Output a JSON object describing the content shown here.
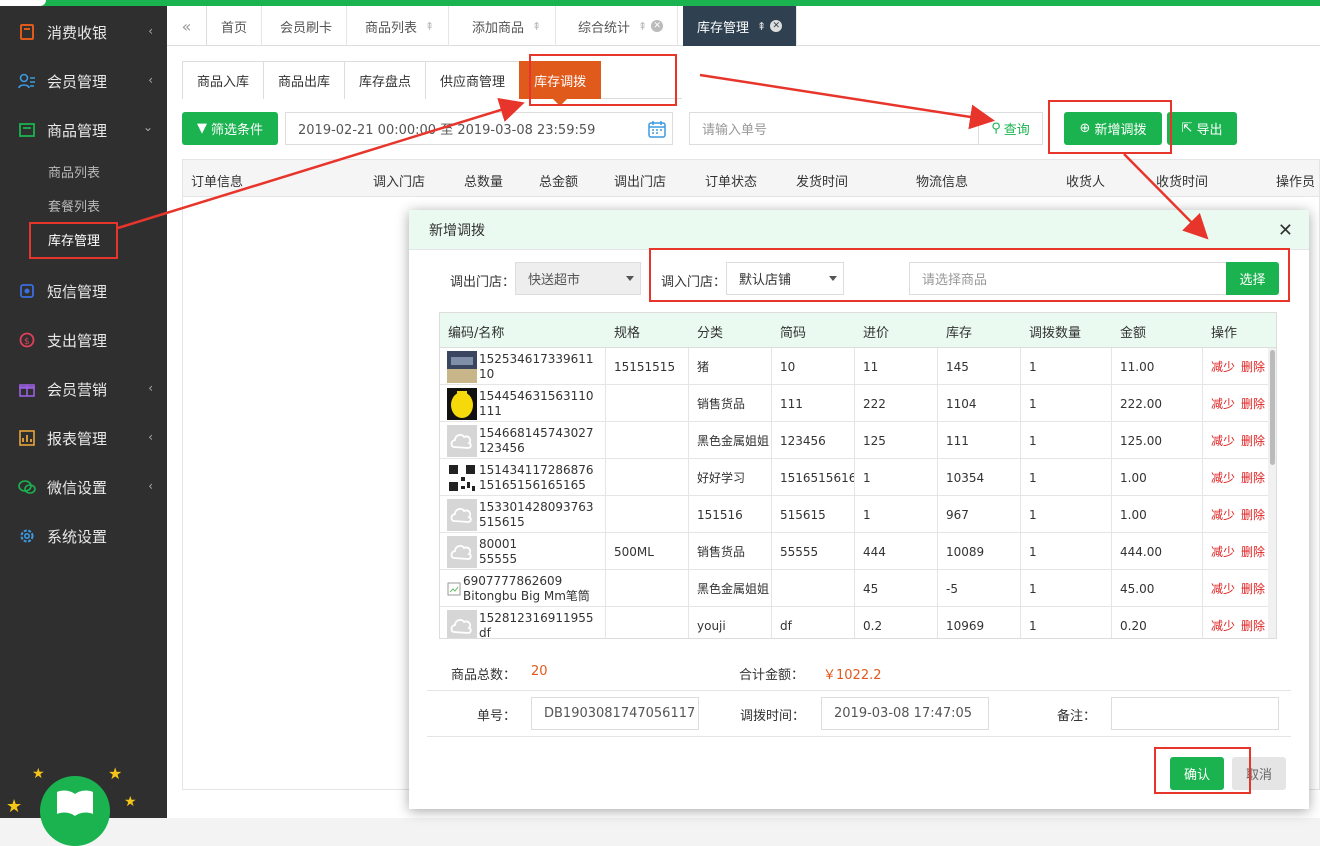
{
  "colors": {
    "green": "#1ab34f",
    "orange": "#e05a1c",
    "sidebar": "#2f2f2f",
    "red_annotation": "#e8352b"
  },
  "sidebar": {
    "items": [
      {
        "label": "消费收银",
        "icon": "cash-register-icon",
        "chevron": "‹"
      },
      {
        "label": "会员管理",
        "icon": "members-icon",
        "chevron": "‹"
      },
      {
        "label": "商品管理",
        "icon": "goods-icon",
        "chevron": "⌄"
      },
      {
        "label": "短信管理",
        "icon": "sms-icon"
      },
      {
        "label": "支出管理",
        "icon": "expense-icon"
      },
      {
        "label": "会员营销",
        "icon": "gift-icon",
        "chevron": "‹"
      },
      {
        "label": "报表管理",
        "icon": "report-icon",
        "chevron": "‹"
      },
      {
        "label": "微信设置",
        "icon": "wechat-icon",
        "chevron": "‹"
      },
      {
        "label": "系统设置",
        "icon": "settings-icon"
      }
    ],
    "subitems": [
      {
        "label": "商品列表"
      },
      {
        "label": "套餐列表"
      },
      {
        "label": "库存管理"
      }
    ]
  },
  "tabs": [
    {
      "label": "首页"
    },
    {
      "label": "会员刷卡"
    },
    {
      "label": "商品列表"
    },
    {
      "label": "添加商品"
    },
    {
      "label": "综合统计"
    },
    {
      "label": "库存管理"
    }
  ],
  "subtabs": [
    {
      "label": "商品入库"
    },
    {
      "label": "商品出库"
    },
    {
      "label": "库存盘点"
    },
    {
      "label": "供应商管理"
    },
    {
      "label": "库存调拨"
    }
  ],
  "toolbar": {
    "filter_label": "筛选条件",
    "date_range": "2019-02-21 00:00:00 至 2019-03-08 23:59:59",
    "order_placeholder": "请输入单号",
    "query_label": "查询",
    "new_transfer_label": "新增调拨",
    "export_label": "导出"
  },
  "list_columns": [
    "订单信息",
    "调入门店",
    "总数量",
    "总金额",
    "调出门店",
    "订单状态",
    "发货时间",
    "物流信息",
    "收货人",
    "收货时间",
    "操作员"
  ],
  "modal": {
    "title": "新增调拨",
    "out_store_label": "调出门店：",
    "out_store_value": "快送超市",
    "in_store_label": "调入门店：",
    "in_store_value": "默认店铺",
    "product_placeholder": "请选择商品",
    "choose_label": "选择",
    "columns": [
      "编码/名称",
      "规格",
      "分类",
      "简码",
      "进价",
      "库存",
      "调拨数量",
      "金额",
      "操作"
    ],
    "rows": [
      {
        "code1": "152534617339611",
        "code2": "10",
        "spec": "15151515",
        "category": "猪",
        "short": "10",
        "price": "11",
        "stock": "145",
        "qty": "1",
        "amount": "11.00",
        "thumb": "photo-dark"
      },
      {
        "code1": "154454631563110",
        "code2": "111",
        "spec": "",
        "category": "销售货品",
        "short": "111",
        "price": "222",
        "stock": "1104",
        "qty": "1",
        "amount": "222.00",
        "thumb": "photo-yellow"
      },
      {
        "code1": "154668145743027",
        "code2": "123456",
        "spec": "",
        "category": "黑色金属姐姐",
        "short": "123456",
        "price": "125",
        "stock": "111",
        "qty": "1",
        "amount": "125.00",
        "thumb": "placeholder"
      },
      {
        "code1": "151434117286876",
        "code2": "15165156165165",
        "spec": "",
        "category": "好好学习",
        "short": "1516515616",
        "price": "1",
        "stock": "10354",
        "qty": "1",
        "amount": "1.00",
        "thumb": "qr"
      },
      {
        "code1": "153301428093763",
        "code2": "515615",
        "spec": "",
        "category": "151516",
        "short": "515615",
        "price": "1",
        "stock": "967",
        "qty": "1",
        "amount": "1.00",
        "thumb": "placeholder"
      },
      {
        "code1": "80001",
        "code2": "55555",
        "spec": "500ML",
        "category": "销售货品",
        "short": "55555",
        "price": "444",
        "stock": "10089",
        "qty": "1",
        "amount": "444.00",
        "thumb": "placeholder"
      },
      {
        "code1": "6907777862609",
        "code2": "Bitongbu Big Mm笔筒",
        "spec": "",
        "category": "黑色金属姐姐",
        "short": "",
        "price": "45",
        "stock": "-5",
        "qty": "1",
        "amount": "45.00",
        "thumb": "broken"
      },
      {
        "code1": "152812316911955",
        "code2": "df",
        "spec": "",
        "category": "youji",
        "short": "df",
        "price": "0.2",
        "stock": "10969",
        "qty": "1",
        "amount": "0.20",
        "thumb": "placeholder"
      }
    ],
    "decrease_label": "减少",
    "delete_label": "删除",
    "total_count_label": "商品总数：",
    "total_count": "20",
    "total_amount_label": "合计金额：",
    "total_amount": "￥1022.2",
    "order_no_label": "单号：",
    "order_no": "DB1903081747056117",
    "time_label": "调拨时间：",
    "time_value": "2019-03-08 17:47:05",
    "remark_label": "备注：",
    "remark_value": "",
    "confirm_label": "确认",
    "cancel_label": "取消"
  }
}
